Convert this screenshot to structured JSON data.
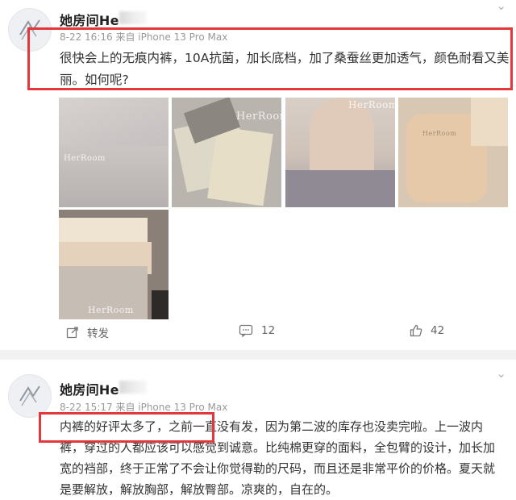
{
  "post1": {
    "author": "她房间He",
    "meta": "8-22 16:16 来自 iPhone 13 Pro Max",
    "more": "⌄",
    "text": "很快会上的无痕内裤，10A抗菌，加长底档，加了桑蚕丝更加透气，颜色耐看又美丽。如何呢?",
    "images": [
      {
        "icon": "fabric-photo",
        "watermark": "HerRoom"
      },
      {
        "icon": "folded-fabric-photo",
        "watermark": "HerRoom"
      },
      {
        "icon": "model-photo",
        "watermark": "HerRoom"
      },
      {
        "icon": "flatlay-photo",
        "watermark": "HerRoom"
      },
      {
        "icon": "stacked-underwear-photo",
        "watermark": "HerRoom"
      }
    ],
    "actions": {
      "repost_label": "转发",
      "comment_count": "12",
      "like_count": "42"
    }
  },
  "post2": {
    "author": "她房间He",
    "meta": "8-22 15:17 来自 iPhone 13 Pro Max",
    "more": "⌄",
    "lines": [
      "内裤的好评太多了，之前一直没有发，因为第二波的库存也没卖完啦。上一波内",
      "裤，穿过的人都应该可以感觉到诚意。比纯棉更穿的面料，全包臂的设计，加长加",
      "宽的裆部，终于正常了不会让你觉得勒的尺码，而且还是非常平价的价格。夏天就",
      "是要解放，解放胸部，解放臀部。凉爽的，自在的。"
    ]
  },
  "colors": {
    "highlight": "#e4373b",
    "meta": "#999999",
    "divider": "#f2f2f2"
  }
}
